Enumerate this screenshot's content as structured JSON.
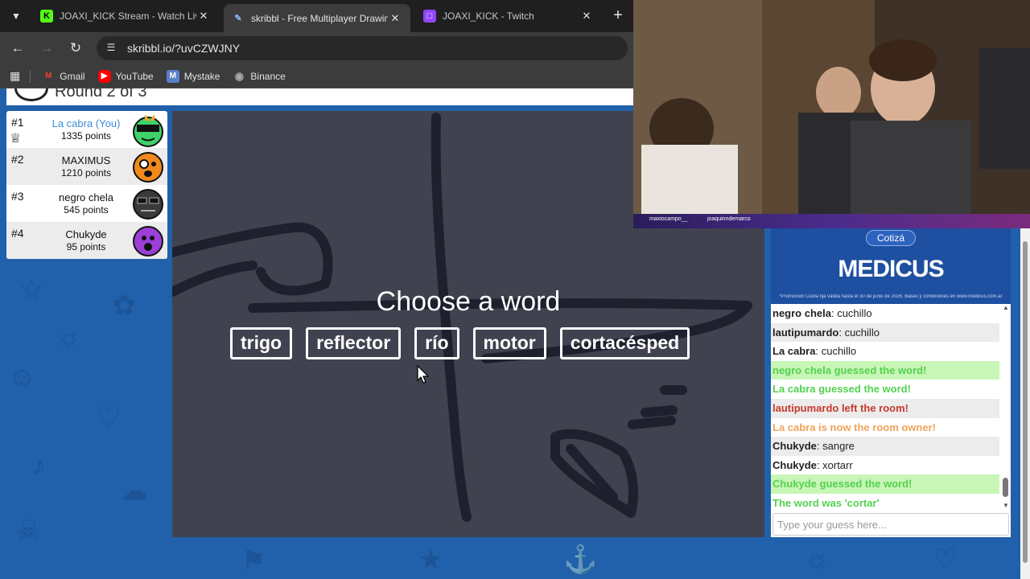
{
  "browser": {
    "tabs": [
      {
        "title": "JOAXI_KICK Stream - Watch Live",
        "icon": "kick-logo",
        "active": false
      },
      {
        "title": "skribbl - Free Multiplayer Drawing",
        "icon": "skribbl-pen",
        "active": true
      },
      {
        "title": "JOAXI_KICK - Twitch",
        "icon": "twitch-logo",
        "active": false
      }
    ],
    "url": "skribbl.io/?uvCZWJNY",
    "bookmarks": [
      {
        "label": "Gmail",
        "icon": "gmail-icon"
      },
      {
        "label": "YouTube",
        "icon": "youtube-icon"
      },
      {
        "label": "Mystake",
        "icon": "mystake-icon"
      },
      {
        "label": "Binance",
        "icon": "globe-icon"
      }
    ]
  },
  "game": {
    "round_text": "Round 2 of 3",
    "players": [
      {
        "rank": "#1",
        "name": "La cabra (You)",
        "points": "1335 points",
        "is_you": true,
        "is_owner": true,
        "avatar_color": "#3fd16a"
      },
      {
        "rank": "#2",
        "name": "MAXIMUS",
        "points": "1210 points",
        "is_you": false,
        "is_owner": false,
        "avatar_color": "#f08a1c"
      },
      {
        "rank": "#3",
        "name": "negro chela",
        "points": "545 points",
        "is_you": false,
        "is_owner": false,
        "avatar_color": "#3a3a3a"
      },
      {
        "rank": "#4",
        "name": "Chukyde",
        "points": "95 points",
        "is_you": false,
        "is_owner": false,
        "avatar_color": "#9b3fd8"
      }
    ],
    "choose_title": "Choose a word",
    "words": [
      "trigo",
      "reflector",
      "río",
      "motor",
      "cortacésped"
    ],
    "chat": [
      {
        "name": "negro chela",
        "text": "cuchillo",
        "type": "message"
      },
      {
        "name": "lautipumardo",
        "text": "cuchillo",
        "type": "message"
      },
      {
        "name": "La cabra",
        "text": "cuchillo",
        "type": "message"
      },
      {
        "name": "",
        "text": "negro chela guessed the word!",
        "type": "guess"
      },
      {
        "name": "",
        "text": "La cabra guessed the word!",
        "type": "guess"
      },
      {
        "name": "",
        "text": "lautipumardo left the room!",
        "type": "left"
      },
      {
        "name": "",
        "text": "La cabra is now the room owner!",
        "type": "owner"
      },
      {
        "name": "Chukyde",
        "text": "sangre",
        "type": "message"
      },
      {
        "name": "Chukyde",
        "text": "xortarr",
        "type": "message"
      },
      {
        "name": "",
        "text": "Chukyde guessed the word!",
        "type": "guess"
      },
      {
        "name": "",
        "text": "The word was 'cortar'",
        "type": "guess"
      }
    ],
    "chat_placeholder": "Type your guess here..."
  },
  "ad": {
    "button": "Cotizá",
    "brand": "MEDICUS",
    "fine_print": "*Promoción Cuota fija válida hasta el 30 de junio de 2026. Bases y condiciones en www.medicus.com.ar"
  },
  "webcam": {
    "names": [
      "maxiocampo__",
      "joaquinndemarco"
    ]
  },
  "colors": {
    "page_bg": "#2160aa",
    "canvas_bg": "#41434f",
    "you_name": "#3c8ed6",
    "guess_green": "#53d14f",
    "left_red": "#c7392b",
    "owner_orange": "#f1a35a"
  }
}
